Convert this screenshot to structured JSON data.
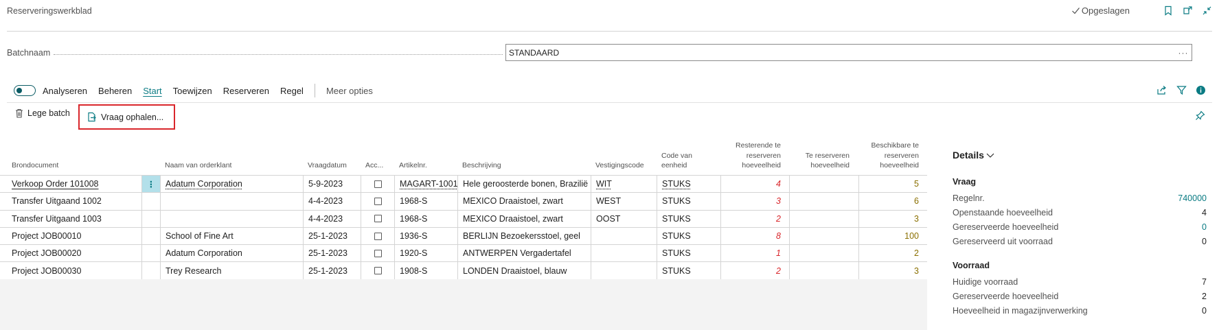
{
  "header": {
    "title": "Reserveringswerkblad",
    "saved_label": "Opgeslagen"
  },
  "batch": {
    "label": "Batchnaam",
    "value": "STANDAARD",
    "more": "···"
  },
  "actionbar": {
    "analyze_label": "Analyseren",
    "items": [
      "Beheren",
      "Start",
      "Toewijzen",
      "Reserveren",
      "Regel"
    ],
    "active": "Start",
    "more_label": "Meer opties"
  },
  "sub_actions": {
    "empty_batch": "Lege batch",
    "get_demand": "Vraag ophalen..."
  },
  "table": {
    "headers": {
      "source": "Brondocument",
      "customer": "Naam van orderklant",
      "demand_date": "Vraagdatum",
      "accept": "Acc...",
      "item_no": "Artikelnr.",
      "description": "Beschrijving",
      "location": "Vestigingscode",
      "uom_l1": "Code van",
      "uom_l2": "eenheid",
      "remaining_l1": "Resterende te",
      "remaining_l2": "reserveren",
      "remaining_l3": "hoeveelheid",
      "to_reserve_l1": "Te reserveren",
      "to_reserve_l2": "hoeveelheid",
      "available_l1": "Beschikbare te",
      "available_l2": "reserveren",
      "available_l3": "hoeveelheid"
    },
    "rows": [
      {
        "source": "Verkoop Order 101008",
        "customer": "Adatum Corporation",
        "date": "5-9-2023",
        "item": "MAGART-1001",
        "desc": "Hele geroosterde bonen, Brazilië",
        "loc": "WIT",
        "uom": "STUKS",
        "remaining": "4",
        "to_reserve": "",
        "available": "5"
      },
      {
        "source": "Transfer Uitgaand 1002",
        "customer": "",
        "date": "4-4-2023",
        "item": "1968-S",
        "desc": "MEXICO Draaistoel, zwart",
        "loc": "WEST",
        "uom": "STUKS",
        "remaining": "3",
        "to_reserve": "",
        "available": "6"
      },
      {
        "source": "Transfer Uitgaand 1003",
        "customer": "",
        "date": "4-4-2023",
        "item": "1968-S",
        "desc": "MEXICO Draaistoel, zwart",
        "loc": "OOST",
        "uom": "STUKS",
        "remaining": "2",
        "to_reserve": "",
        "available": "3"
      },
      {
        "source": "Project JOB00010",
        "customer": "School of Fine Art",
        "date": "25-1-2023",
        "item": "1936-S",
        "desc": "BERLIJN Bezoekersstoel, geel",
        "loc": "",
        "uom": "STUKS",
        "remaining": "8",
        "to_reserve": "",
        "available": "100"
      },
      {
        "source": "Project JOB00020",
        "customer": "Adatum Corporation",
        "date": "25-1-2023",
        "item": "1920-S",
        "desc": "ANTWERPEN Vergadertafel",
        "loc": "",
        "uom": "STUKS",
        "remaining": "1",
        "to_reserve": "",
        "available": "2"
      },
      {
        "source": "Project JOB00030",
        "customer": "Trey Research",
        "date": "25-1-2023",
        "item": "1908-S",
        "desc": "LONDEN Draaistoel, blauw",
        "loc": "",
        "uom": "STUKS",
        "remaining": "2",
        "to_reserve": "",
        "available": "3"
      }
    ]
  },
  "details": {
    "title": "Details",
    "demand": {
      "heading": "Vraag",
      "rows": [
        {
          "label": "Regelnr.",
          "value": "740000"
        },
        {
          "label": "Openstaande hoeveelheid",
          "value": "4"
        },
        {
          "label": "Gereserveerde hoeveelheid",
          "value": "0"
        },
        {
          "label": "Gereserveerd uit voorraad",
          "value": "0"
        }
      ]
    },
    "inventory": {
      "heading": "Voorraad",
      "rows": [
        {
          "label": "Huidige voorraad",
          "value": "7"
        },
        {
          "label": "Gereserveerde hoeveelheid",
          "value": "2"
        },
        {
          "label": "Hoeveelheid in magazijnverwerking",
          "value": "0"
        }
      ]
    }
  },
  "colors": {
    "accent": "#0a7b83",
    "alert": "#d9262b",
    "highlight": "#b3e0ea"
  }
}
